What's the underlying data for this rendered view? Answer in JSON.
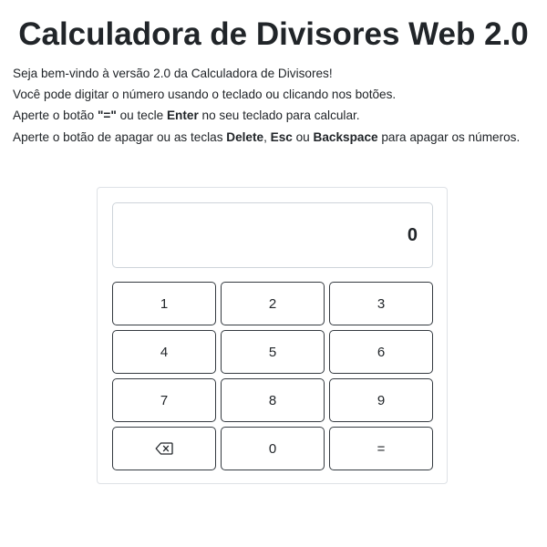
{
  "title": "Calculadora de Divisores Web 2.0",
  "intro": {
    "line1": "Seja bem-vindo à versão 2.0 da Calculadora de Divisores!",
    "line2": "Você pode digitar o número usando o teclado ou clicando nos botões.",
    "line3_a": "Aperte o botão ",
    "line3_b": "\"=\"",
    "line3_c": " ou tecle ",
    "line3_d": "Enter",
    "line3_e": " no seu teclado para calcular.",
    "line4_a": "Aperte o botão de apagar ou as teclas ",
    "line4_b": "Delete",
    "line4_c": ", ",
    "line4_d": "Esc",
    "line4_e": " ou ",
    "line4_f": "Backspace",
    "line4_g": " para apagar os números."
  },
  "calculator": {
    "display_value": "0",
    "keys": {
      "k1": "1",
      "k2": "2",
      "k3": "3",
      "k4": "4",
      "k5": "5",
      "k6": "6",
      "k7": "7",
      "k8": "8",
      "k9": "9",
      "backspace_icon": "backspace-icon",
      "k0": "0",
      "equals": "="
    }
  }
}
